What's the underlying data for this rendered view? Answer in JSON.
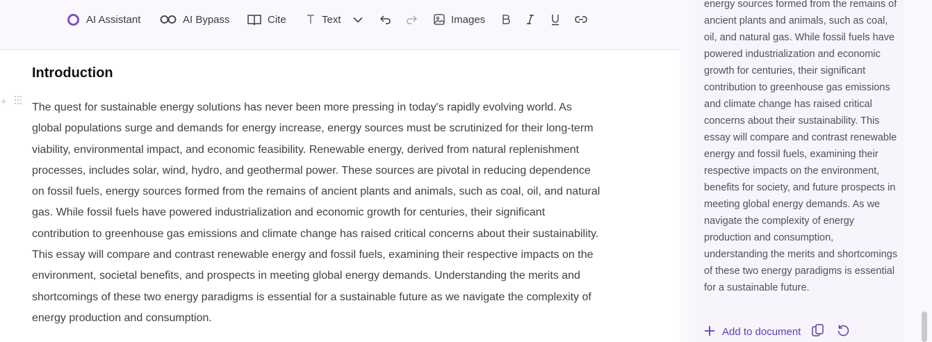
{
  "toolbar": {
    "ai_assistant": "AI Assistant",
    "ai_bypass": "AI Bypass",
    "cite": "Cite",
    "text_style": "Text",
    "images": "Images"
  },
  "editor": {
    "heading": "Introduction",
    "paragraph": "The quest for sustainable energy solutions has never been more pressing in today's rapidly evolving world. As global populations surge and demands for energy increase, energy sources must be scrutinized for their long-term viability, environmental impact, and economic feasibility. Renewable energy, derived from natural replenishment processes, includes solar, wind, hydro, and geothermal power. These sources are pivotal in reducing dependence on fossil fuels, energy sources formed from the remains of ancient plants and animals, such as coal, oil, and natural gas. While fossil fuels have powered industrialization and economic growth for centuries, their significant contribution to greenhouse gas emissions and climate change has raised critical concerns about their sustainability. This essay will compare and contrast renewable energy and fossil fuels, examining their respective impacts on the environment, societal benefits, and prospects in meeting global energy demands. Understanding the merits and shortcomings of these two energy paradigms is essential for a sustainable future as we navigate the complexity of energy production and consumption."
  },
  "side_panel": {
    "suggestion_text": "energy sources formed from the remains of ancient plants and animals, such as coal, oil, and natural gas. While fossil fuels have powered industrialization and economic growth for centuries, their significant contribution to greenhouse gas emissions and climate change has raised critical concerns about their sustainability. This essay will compare and contrast renewable energy and fossil fuels, examining their respective impacts on the environment, benefits for society, and future prospects in meeting global energy demands. As we navigate the complexity of energy production and consumption, understanding the merits and shortcomings of these two energy paradigms is essential for a sustainable future.",
    "add_to_document": "Add to document"
  },
  "colors": {
    "accent": "#5b3fb0",
    "assistant_ring": "#7c4fd0",
    "toolbar_bg": "#faf8fd"
  },
  "icons": [
    "ai-assistant-icon",
    "infinity-icon",
    "book-icon",
    "text-icon",
    "chevron-down-icon",
    "undo-icon",
    "redo-icon",
    "image-icon",
    "bold-icon",
    "italic-icon",
    "underline-icon",
    "link-icon",
    "plus-icon",
    "copy-icon",
    "regenerate-icon"
  ]
}
